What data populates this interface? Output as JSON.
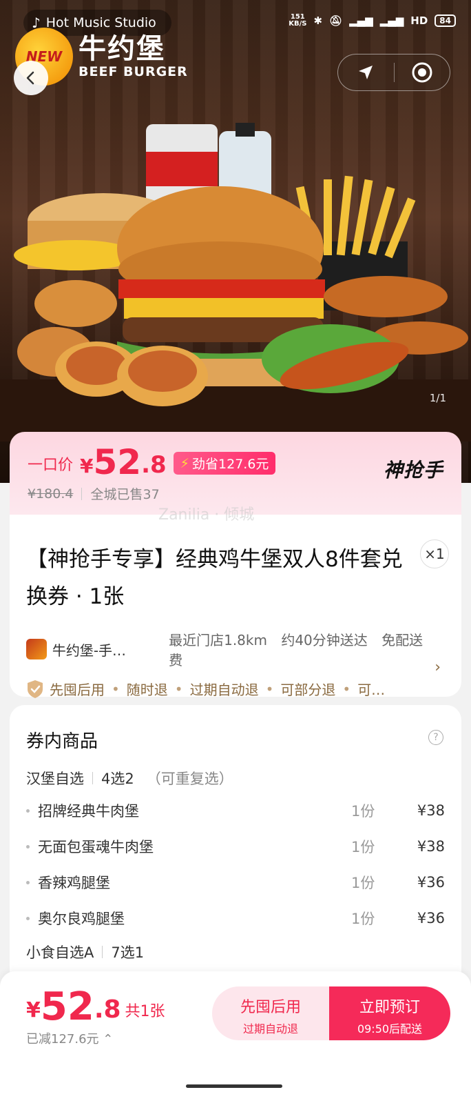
{
  "status_bar": {
    "music_text": "Hot Music Studio",
    "speed_value": "151",
    "speed_unit": "KB/S",
    "network": "HD",
    "battery": "84"
  },
  "brand": {
    "badge_text": "NEW",
    "name_cn": "牛约堡",
    "name_en": "BEEF BURGER"
  },
  "gallery": {
    "counter": "1/1"
  },
  "price_card": {
    "label": "一口价",
    "currency": "¥",
    "price_int": "52",
    "price_dec": ".8",
    "save_tag": "劲省127.6元",
    "original_price": "¥180.4",
    "sold": "全城已售37",
    "brand_logo": "神抢手"
  },
  "detail": {
    "watermark": "Zanilia · 倾城",
    "title": "【神抢手专享】经典鸡牛堡双人8件套兑换券 · 1张",
    "qty": "×1",
    "store_name": "牛约堡-手…",
    "distance": "最近门店1.8km",
    "delivery_time": "约40分钟送达",
    "delivery_fee": "免配送费",
    "tags": [
      "先囤后用",
      "随时退",
      "过期自动退",
      "可部分退",
      "可…"
    ]
  },
  "contents": {
    "title": "券内商品",
    "group1": {
      "name": "汉堡自选",
      "rule": "4选2",
      "hint": "（可重复选）"
    },
    "items": [
      {
        "name": "招牌经典牛肉堡",
        "portion": "1份",
        "price": "¥38"
      },
      {
        "name": "无面包蛋魂牛肉堡",
        "portion": "1份",
        "price": "¥38"
      },
      {
        "name": "香辣鸡腿堡",
        "portion": "1份",
        "price": "¥36"
      },
      {
        "name": "奥尔良鸡腿堡",
        "portion": "1份",
        "price": "¥36"
      }
    ],
    "group2": {
      "name": "小食自选A",
      "rule": "7选1"
    }
  },
  "bottom_bar": {
    "currency": "¥",
    "price_int": "52",
    "price_dec": ".8",
    "count": "共1张",
    "saved": "已减127.6元",
    "later_label": "先囤后用",
    "later_sub": "过期自动退",
    "book_label": "立即预订",
    "book_sub": "09:50后配送"
  },
  "colors": {
    "accent": "#f0284d",
    "accent_button": "#f52a59",
    "pink_bg": "#fde6ec",
    "tag_brown": "#8a6a40"
  }
}
